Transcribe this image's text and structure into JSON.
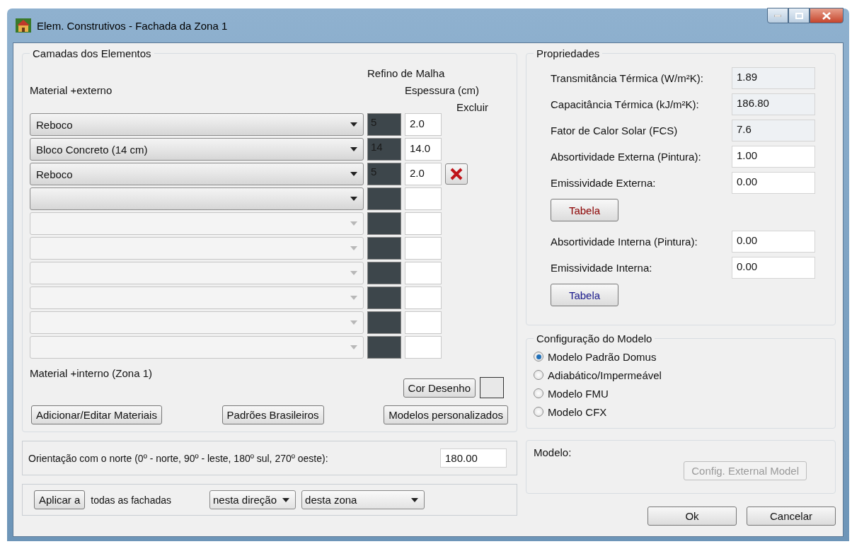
{
  "window": {
    "title": "Elem. Construtivos - Fachada da Zona 1"
  },
  "layers": {
    "title": "Camadas dos Elementos",
    "outer_label": "Material +externo",
    "col_mesh": "Refino de Malha",
    "col_thickness": "Espessura (cm)",
    "col_delete": "Excluir",
    "inner_label": "Material +interno (Zona 1)",
    "rows": [
      {
        "material": "Reboco",
        "mesh": "5",
        "thickness": "2.0",
        "disabled": false,
        "deletable": false
      },
      {
        "material": "Bloco Concreto (14 cm)",
        "mesh": "14",
        "thickness": "14.0",
        "disabled": false,
        "deletable": false
      },
      {
        "material": "Reboco",
        "mesh": "5",
        "thickness": "2.0",
        "disabled": false,
        "deletable": true
      },
      {
        "disabled": false,
        "deletable": false
      },
      {
        "disabled": true,
        "deletable": false
      },
      {
        "disabled": true,
        "deletable": false
      },
      {
        "disabled": true,
        "deletable": false
      },
      {
        "disabled": true,
        "deletable": false
      },
      {
        "disabled": true,
        "deletable": false
      },
      {
        "disabled": true,
        "deletable": false
      }
    ],
    "draw_color_button": "Cor Desenho",
    "buttons": [
      "Adicionar/Editar Materiais",
      "Padrões Brasileiros",
      "Modelos personalizados"
    ]
  },
  "orientation": {
    "label": "Orientação com o norte (0º - norte, 90º - leste, 180º sul, 270º oeste):",
    "value": "180.00"
  },
  "apply": {
    "button": "Aplicar a",
    "text": "todas as fachadas",
    "direction": "nesta direção",
    "zone": "desta zona"
  },
  "properties": {
    "title": "Propriedades",
    "items": [
      {
        "kind": "field",
        "label": "Transmitância Térmica (W/m²K):",
        "value": "1.89",
        "readonly": true
      },
      {
        "kind": "field",
        "label": "Capacitância Térmica (kJ/m²K):",
        "value": "186.80",
        "readonly": true
      },
      {
        "kind": "field",
        "label": "Fator de Calor Solar (FCS)",
        "value": "7.6",
        "readonly": true
      },
      {
        "kind": "field",
        "label": "Absortividade Externa (Pintura):",
        "value": "1.00",
        "readonly": false
      },
      {
        "kind": "field",
        "label": "Emissividade Externa:",
        "value": "0.00",
        "readonly": false
      },
      {
        "kind": "button",
        "label": "Tabela",
        "color": "#8b0000"
      },
      {
        "kind": "field",
        "label": "Absortividade Interna (Pintura):",
        "value": "0.00",
        "readonly": false
      },
      {
        "kind": "field",
        "label": "Emissividade Interna:",
        "value": "0.00",
        "readonly": false
      },
      {
        "kind": "button",
        "label": "Tabela",
        "color": "#1a1a8c"
      }
    ]
  },
  "model_config": {
    "title": "Configuração do Modelo",
    "options": [
      {
        "label": "Modelo Padrão Domus",
        "selected": true
      },
      {
        "label": "Adiabático/Impermeável",
        "selected": false
      },
      {
        "label": "Modelo FMU",
        "selected": false
      },
      {
        "label": "Modelo CFX",
        "selected": false
      }
    ]
  },
  "model": {
    "label": "Modelo:",
    "button": "Config. External Model",
    "disabled": true
  },
  "footer": {
    "ok": "Ok",
    "cancel": "Cancelar"
  }
}
